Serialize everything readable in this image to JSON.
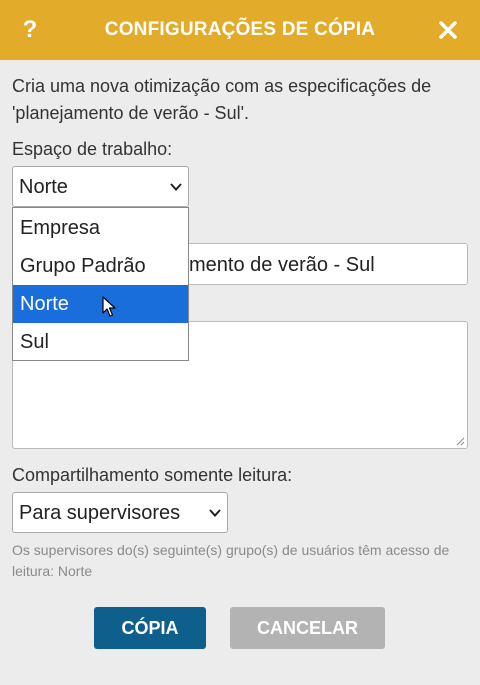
{
  "header": {
    "help_icon": "?",
    "title": "CONFIGURAÇÕES DE CÓPIA",
    "close_icon": "close-icon"
  },
  "description": "Cria uma nova otimização com as especificações de 'planejamento de verão - Sul'.",
  "workspace": {
    "label": "Espaço de trabalho:",
    "value": "Norte",
    "options": [
      "Empresa",
      "Grupo Padrão",
      "Norte",
      "Sul"
    ],
    "selected_index": 2
  },
  "name_field": {
    "visible_value": "mento de verão - Sul"
  },
  "sharing": {
    "label": "Compartilhamento somente leitura:",
    "value": "Para supervisores",
    "note": "Os supervisores do(s) seguinte(s) grupo(s) de usuários têm acesso de leitura: Norte"
  },
  "buttons": {
    "copy": "CÓPIA",
    "cancel": "CANCELAR"
  },
  "colors": {
    "header": "#e3ab2a",
    "copy_button": "#0f5f8c",
    "cancel_button": "#b3b3b3",
    "selected_option": "#1a6edc",
    "background": "#ececec"
  }
}
